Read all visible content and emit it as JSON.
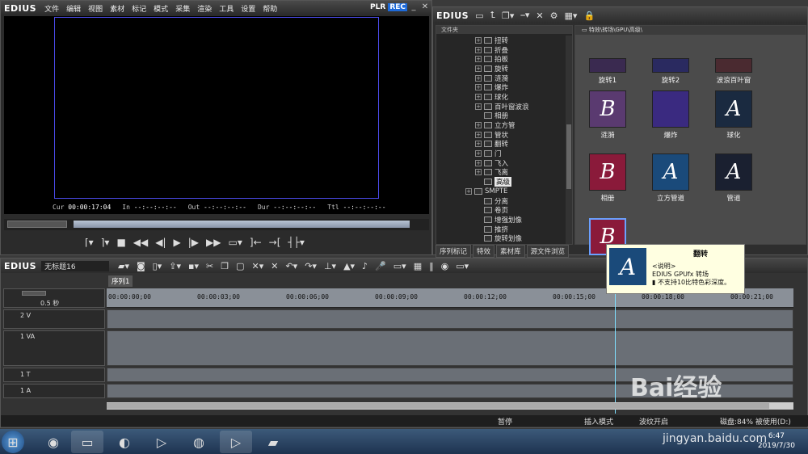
{
  "player": {
    "logo": "EDIUS",
    "menu": [
      "文件",
      "编辑",
      "视图",
      "素材",
      "标记",
      "模式",
      "采集",
      "渲染",
      "工具",
      "设置",
      "帮助"
    ],
    "plr": "PLR",
    "rec": "REC",
    "timecodes": [
      {
        "label": "Cur",
        "value": "00:00:17:04"
      },
      {
        "label": "In",
        "value": "--:--:--:--"
      },
      {
        "label": "Out",
        "value": "--:--:--:--"
      },
      {
        "label": "Dur",
        "value": "--:--:--:--"
      },
      {
        "label": "Ttl",
        "value": "--:--:--:--"
      }
    ]
  },
  "bin": {
    "logo": "EDIUS",
    "folder_header": "文件夹",
    "path": "特效\\转场\\GPU\\高级\\",
    "tree": [
      {
        "label": "扭转",
        "plus": true
      },
      {
        "label": "折叠",
        "plus": true
      },
      {
        "label": "拍板",
        "plus": true
      },
      {
        "label": "旋转",
        "plus": true
      },
      {
        "label": "涟漪",
        "plus": true
      },
      {
        "label": "爆炸",
        "plus": true
      },
      {
        "label": "球化",
        "plus": true
      },
      {
        "label": "百叶窗波浪",
        "plus": true
      },
      {
        "label": "相册",
        "plus": false
      },
      {
        "label": "立方管",
        "plus": true
      },
      {
        "label": "管状",
        "plus": true
      },
      {
        "label": "翻转",
        "plus": true
      },
      {
        "label": "门",
        "plus": true
      },
      {
        "label": "飞入",
        "plus": true
      },
      {
        "label": "飞离",
        "plus": true
      },
      {
        "label": "高级",
        "plus": false,
        "selected": true
      },
      {
        "label": "SMPTE",
        "plus": true
      },
      {
        "label": "分离",
        "plus": false
      },
      {
        "label": "卷页",
        "plus": false
      },
      {
        "label": "增强划像",
        "plus": false
      },
      {
        "label": "推挤",
        "plus": false
      },
      {
        "label": "旋转划像",
        "plus": false
      }
    ],
    "thumbs": [
      {
        "label": "旋转1",
        "glyph": "",
        "color": "#3a2a50"
      },
      {
        "label": "旋转2",
        "glyph": "",
        "color": "#2a2a60"
      },
      {
        "label": "波浪百叶窗",
        "glyph": "",
        "color": "#4a2a30"
      },
      {
        "label": "涟漪",
        "glyph": "B",
        "color": "#5a3a70"
      },
      {
        "label": "爆炸",
        "glyph": "",
        "color": "#3a2a80"
      },
      {
        "label": "球化",
        "glyph": "A",
        "color": "#1a2a40"
      },
      {
        "label": "相册",
        "glyph": "B",
        "color": "#8a1a3a"
      },
      {
        "label": "立方管道",
        "glyph": "A",
        "color": "#1a4a7a"
      },
      {
        "label": "管道",
        "glyph": "A",
        "color": "#1a2030"
      },
      {
        "label": "翻转",
        "glyph": "B",
        "color": "#8a1a3a",
        "selected": true
      }
    ],
    "tabs": [
      "序列标记",
      "特效",
      "素材库",
      "源文件浏览"
    ]
  },
  "timeline": {
    "logo": "EDIUS",
    "project": "无标题16",
    "sequence_tab": "序列1",
    "zoom": "0.5 秒",
    "ruler": [
      "00:00:00;00",
      "00:00:03;00",
      "00:00:06;00",
      "00:00:09;00",
      "00:00:12;00",
      "00:00:15;00",
      "00:00:18;00",
      "00:00:21;00"
    ],
    "tracks": [
      "2 V",
      "1 VA",
      "1 T",
      "1 A"
    ],
    "status": {
      "pause": "暂停",
      "insert": "插入模式",
      "ripple": "波纹开启",
      "disk": "磁盘:84% 被使用(D:)"
    }
  },
  "tooltip": {
    "title": "翻转",
    "line1": "<说明>",
    "line2": "EDIUS GPUfx 转场",
    "line3": "不支持10比特色彩深度。",
    "glyph": "A"
  },
  "taskbar": {
    "time": "6:47",
    "date": "2019/7/30"
  },
  "watermark": {
    "text": "Bai经验",
    "url": "jingyan.baidu.com"
  }
}
